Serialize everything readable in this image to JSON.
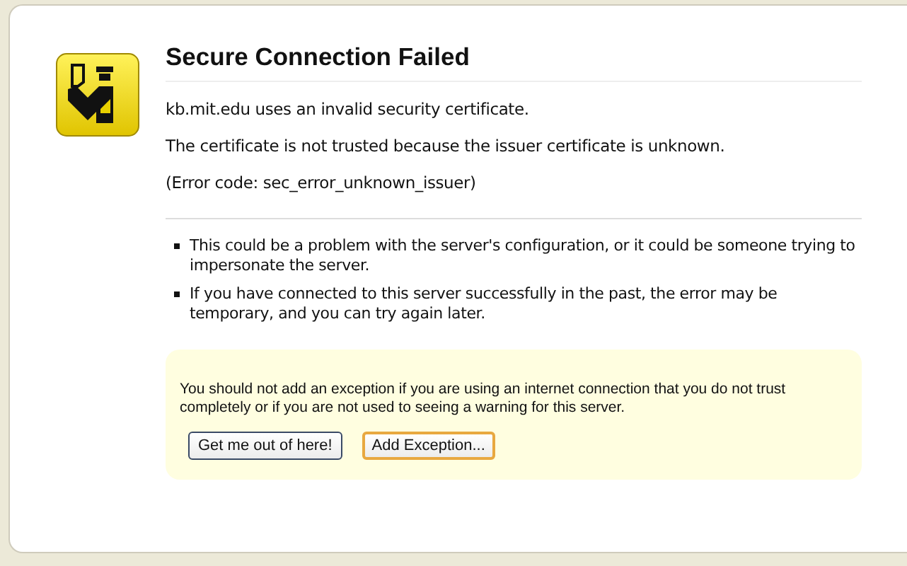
{
  "title": "Secure Connection Failed",
  "short_description": "kb.mit.edu uses an invalid security certificate.",
  "details": [
    "The certificate is not trusted because the issuer certificate is unknown.",
    "(Error code: sec_error_unknown_issuer)"
  ],
  "bullets": [
    "This could be a problem with the server's configuration, or it could be someone trying to impersonate the server.",
    "If you have connected to this server successfully in the past, the error may be temporary, and you can try again later."
  ],
  "warning": {
    "text": "You should not add an exception if you are using an internet connection that you do not trust completely or if you are not used to seeing a warning for this server.",
    "buttons": [
      {
        "label": "Get me out of here!",
        "focused": false
      },
      {
        "label": "Add Exception...",
        "focused": true
      }
    ]
  }
}
